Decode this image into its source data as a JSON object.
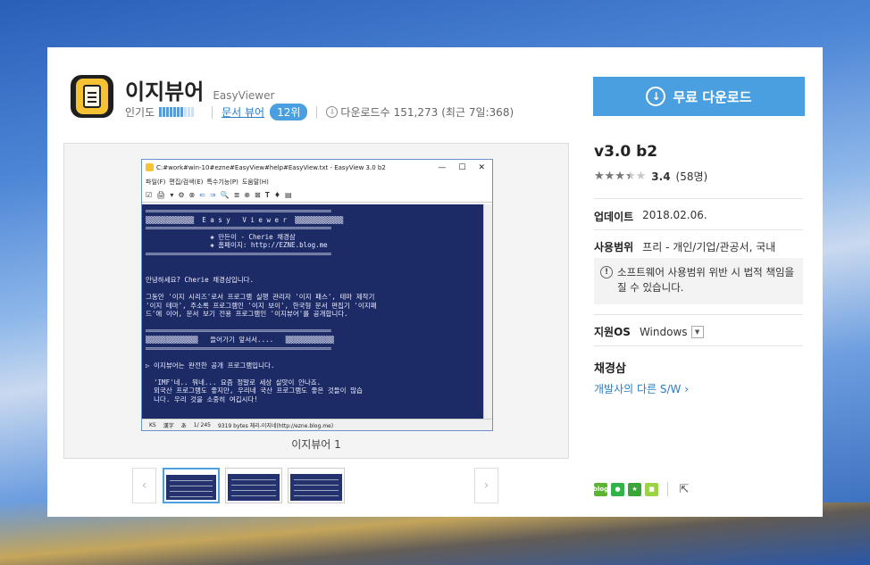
{
  "app": {
    "name_ko": "이지뷰어",
    "name_en": "EasyViewer"
  },
  "meta": {
    "popularity_label": "인기도",
    "popularity_level": 0.7,
    "category_link": "문서 뷰어",
    "rank": "12위",
    "downloads_label": "다운로드수",
    "downloads_count": "151,273",
    "recent": "(최근 7일:368)"
  },
  "download_button": {
    "label": "무료 다운로드"
  },
  "screenshot": {
    "caption": "이지뷰어 1",
    "window_title": "C:#work#win-10#ezne#EasyView#help#EasyView.txt - EasyView 3.0 b2",
    "menu": [
      "파일(F)",
      "편집/검색(E)",
      "특수기능(P)",
      "도움말(H)"
    ],
    "body_text": "══════════════════════════════════════════════\n▒▒▒▒▒▒▒▒▒▒▒▒  E a s y   V i e w e r  ▒▒▒▒▒▒▒▒▒▒▒▒\n══════════════════════════════════════════════\n                ◈ 만든이 - Cherie 채경삼\n                ◈ 홈페이지: http://EZNE.blog.me\n══════════════════════════════════════════════\n\n\n안녕하세요? Cherie 채경삼입니다.\n\n그동안 '이지 시리즈'로서 프로그램 실행 관리자 '이지 패스', 테마 제작기\n'이지 테마', 주소록 프로그램인 '이지 보이', 한국형 문서 편집기 '이지패\n드'에 이어, 문서 보기 전용 프로그램인 '이지뷰어'를 공개합니다.\n\n══════════════════════════════════════════════\n▒▒▒▒▒▒▒▒▒▒▒▒▒   들어가기 앞서서....   ▒▒▒▒▒▒▒▒▒▒▒▒\n══════════════════════════════════════════════\n\n▷ 이지뷰어는 완전한 공개 프로그램입니다.\n\n  'IMF'네.. 뭐네... 요즘 정말로 세상 살맛이 안나죠.\n  외국산 프로그램도 좋지만, 우리네 국산 프로그램도 좋은 것들이 많습\n  니다. 우리 것을 소중히 여깁시다!",
    "status": [
      "KS",
      "漢字",
      "あ",
      "1/ 245",
      "9319 bytes 체리-이지네(http://ezne.blog.me)"
    ]
  },
  "thumbnails": {
    "count": 3,
    "active_index": 0
  },
  "sidebar": {
    "version": "v3.0 b2",
    "rating_value": 3.4,
    "rating_score": "3.4",
    "rating_count": "(58명)",
    "update_label": "업데이트",
    "update_date": "2018.02.06.",
    "license_label": "사용범위",
    "license_value": "프리 - 개인/기업/관공서, 국내",
    "warning": "소프트웨어 사용범위 위반 시 법적 책임을 질 수 있습니다.",
    "os_label": "지원OS",
    "os_value": "Windows",
    "developer": "채경삼",
    "developer_link": "개발사의 다른 S/W ›"
  },
  "colors": {
    "accent": "#4a9fe0",
    "link": "#2a7cc7"
  }
}
